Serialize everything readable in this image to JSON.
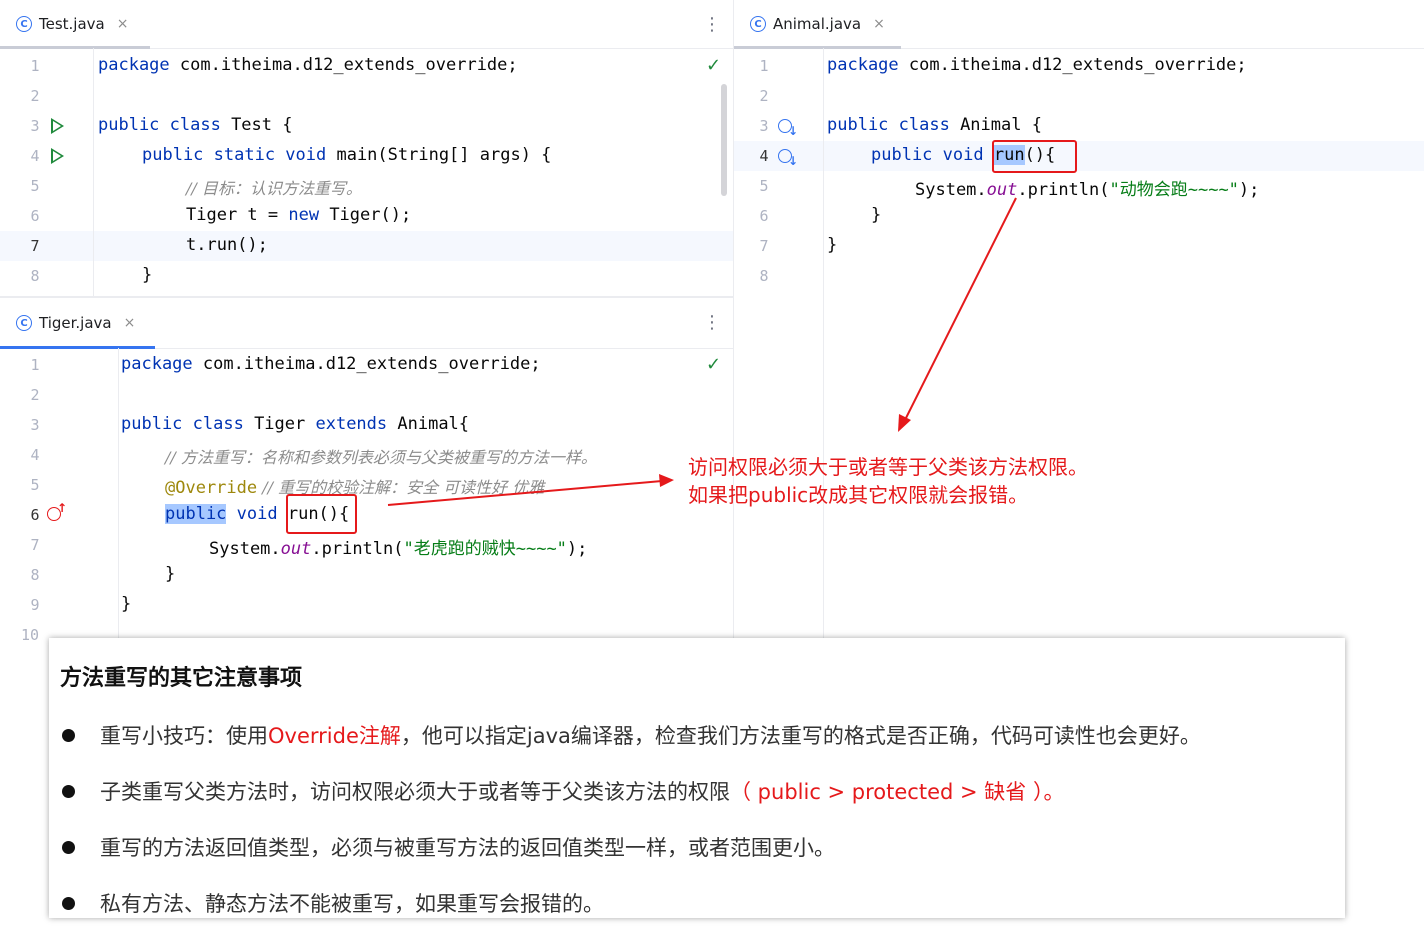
{
  "test_editor": {
    "tab_label": "Test.java",
    "close_glyph": "×",
    "menu_glyph": "⋮",
    "line_numbers": [
      "1",
      "2",
      "3",
      "4",
      "5",
      "6",
      "7",
      "8"
    ],
    "lines": {
      "l1_kw": "package",
      "l1_rest": " com.itheima.d12_extends_override;",
      "l3_kw": "public class",
      "l3_rest": " Test {",
      "l4_kw": "public static void",
      "l4_rest": " main(String[] args) {",
      "l5_comment": "// 目标：认识方法重写。",
      "l6_a": "Tiger t = ",
      "l6_kw": "new",
      "l6_b": " Tiger();",
      "l7": "t.run();",
      "l8": "}"
    }
  },
  "animal_editor": {
    "tab_label": "Animal.java",
    "close_glyph": "×",
    "line_numbers": [
      "1",
      "2",
      "3",
      "4",
      "5",
      "6",
      "7",
      "8"
    ],
    "lines": {
      "l1_kw": "package",
      "l1_rest": " com.itheima.d12_extends_override;",
      "l3_kw": "public class",
      "l3_rest": " Animal {",
      "l4_kw": "public void",
      "l4_run": "run",
      "l4_rest": "(){",
      "l5_a": "System.",
      "l5_field": "out",
      "l5_b": ".println(",
      "l5_str": "\"动物会跑~~~~\"",
      "l5_c": ");",
      "l6": "}",
      "l7": "}"
    }
  },
  "tiger_editor": {
    "tab_label": "Tiger.java",
    "close_glyph": "×",
    "menu_glyph": "⋮",
    "line_numbers": [
      "1",
      "2",
      "3",
      "4",
      "5",
      "6",
      "7",
      "8",
      "9",
      "10"
    ],
    "lines": {
      "l1_kw": "package",
      "l1_rest": " com.itheima.d12_extends_override;",
      "l3_kw": "public class",
      "l3_mid": " Tiger ",
      "l3_kw2": "extends",
      "l3_rest": " Animal{",
      "l4_comment": "// 方法重写：名称和参数列表必须与父类被重写的方法一样。",
      "l5_annot": "@Override",
      "l5_comment": " // 重写的校验注解：安全 可读性好 优雅",
      "l6_kw1": "public",
      "l6_kw2": " void",
      "l6_rest": " run(){",
      "l7_a": "System.",
      "l7_field": "out",
      "l7_b": ".println(",
      "l7_str": "\"老虎跑的贼快~~~~\"",
      "l7_c": ");",
      "l8": "}",
      "l9": "}"
    }
  },
  "annotation": {
    "line1": "访问权限必须大于或者等于父类该方法权限。",
    "line2": "如果把public改成其它权限就会报错。",
    "color": "#e5191b"
  },
  "notes_card": {
    "title": "方法重写的其它注意事项",
    "items": [
      {
        "pre": "重写小技巧：使用",
        "highlight": "Override注解",
        "post": "，他可以指定java编译器，检查我们方法重写的格式是否正确，代码可读性也会更好。"
      },
      {
        "pre": "子类重写父类方法时，访问权限必须大于或者等于父类该方法的权限",
        "highlight": "（ public > protected > 缺省 ）",
        "post": "。"
      },
      {
        "pre": "重写的方法返回值类型，必须与被重写方法的返回值类型一样，或者范围更小。",
        "highlight": "",
        "post": ""
      },
      {
        "pre": "私有方法、静态方法不能被重写，如果重写会报错的。",
        "highlight": "",
        "post": ""
      }
    ]
  },
  "colors": {
    "keyword": "#0033b3",
    "tab_active": "#3574f0",
    "check": "#208a3c"
  }
}
